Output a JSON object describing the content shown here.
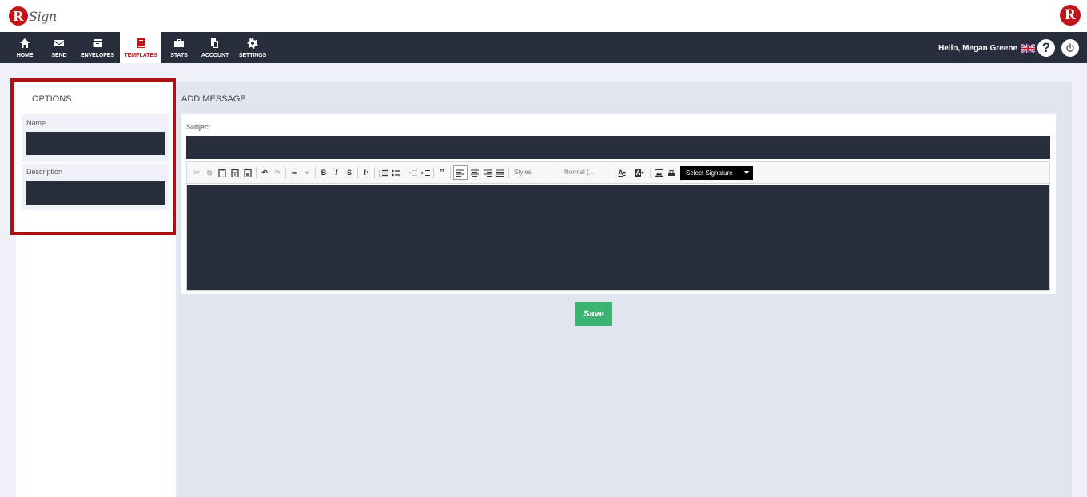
{
  "brand": {
    "logo_letter": "R",
    "logo_word": "Sign",
    "right_logo_letter": "R"
  },
  "nav": {
    "items": [
      {
        "label": "HOME",
        "icon": "home-icon"
      },
      {
        "label": "SEND",
        "icon": "envelope-icon"
      },
      {
        "label": "ENVELOPES",
        "icon": "inbox-icon"
      },
      {
        "label": "TEMPLATES",
        "icon": "book-icon",
        "active": true
      },
      {
        "label": "STATS",
        "icon": "briefcase-icon"
      },
      {
        "label": "ACCOUNT",
        "icon": "copy-icon"
      },
      {
        "label": "SETTINGS",
        "icon": "gear-icon"
      }
    ],
    "greeting": "Hello, Megan Greene",
    "help_glyph": "?"
  },
  "options": {
    "title": "OPTIONS",
    "name_label": "Name",
    "name_value": "",
    "description_label": "Description",
    "description_value": ""
  },
  "message": {
    "title": "ADD MESSAGE",
    "subject_label": "Subject",
    "subject_value": "",
    "styles_combo": "Styles",
    "format_combo": "Normal (...",
    "signature_select": "Select Signature",
    "body_value": ""
  },
  "actions": {
    "save_label": "Save"
  },
  "colors": {
    "brand_red": "#c0141b",
    "nav_bg": "#272d3a",
    "highlight": "#ad0e11",
    "save_green": "#3cb371"
  }
}
